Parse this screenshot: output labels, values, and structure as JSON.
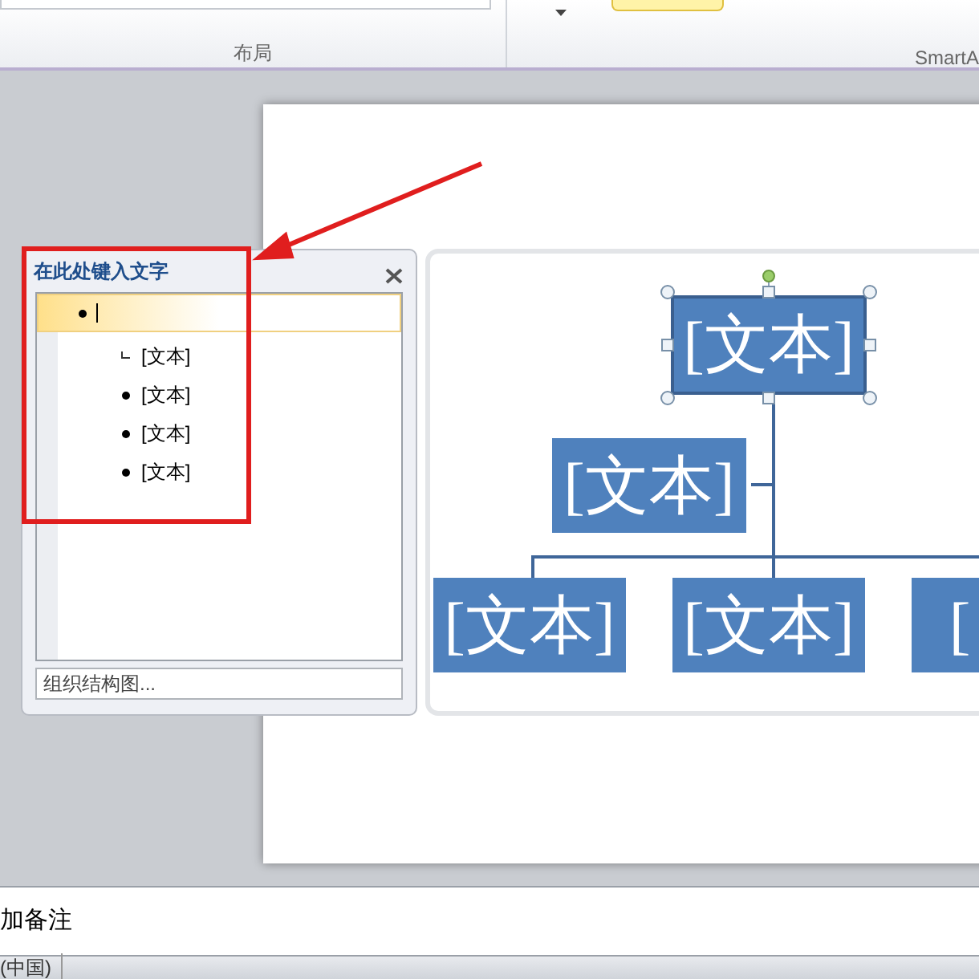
{
  "ribbon": {
    "groups": [
      {
        "label": "布局"
      },
      {
        "label": "SmartA"
      }
    ]
  },
  "text_pane": {
    "title": "在此处键入文字",
    "items": [
      {
        "selected": true,
        "children": [
          {
            "text": "[文本]",
            "kind": "assistant"
          },
          {
            "text": "[文本]",
            "kind": "bullet"
          },
          {
            "text": "[文本]",
            "kind": "bullet"
          },
          {
            "text": "[文本]",
            "kind": "bullet"
          }
        ]
      }
    ],
    "footer_link": "组织结构图..."
  },
  "diagram": {
    "top": {
      "text": "[文本]",
      "selected": true
    },
    "assistant": {
      "text": "[文本]",
      "selected": false
    },
    "children": [
      {
        "text": "[文本]",
        "selected": false
      },
      {
        "text": "[文本]",
        "selected": false
      },
      {
        "text": "[",
        "selected": false
      }
    ]
  },
  "notes": {
    "text": "加备注"
  },
  "status_bar": {
    "language": "(中国)"
  }
}
